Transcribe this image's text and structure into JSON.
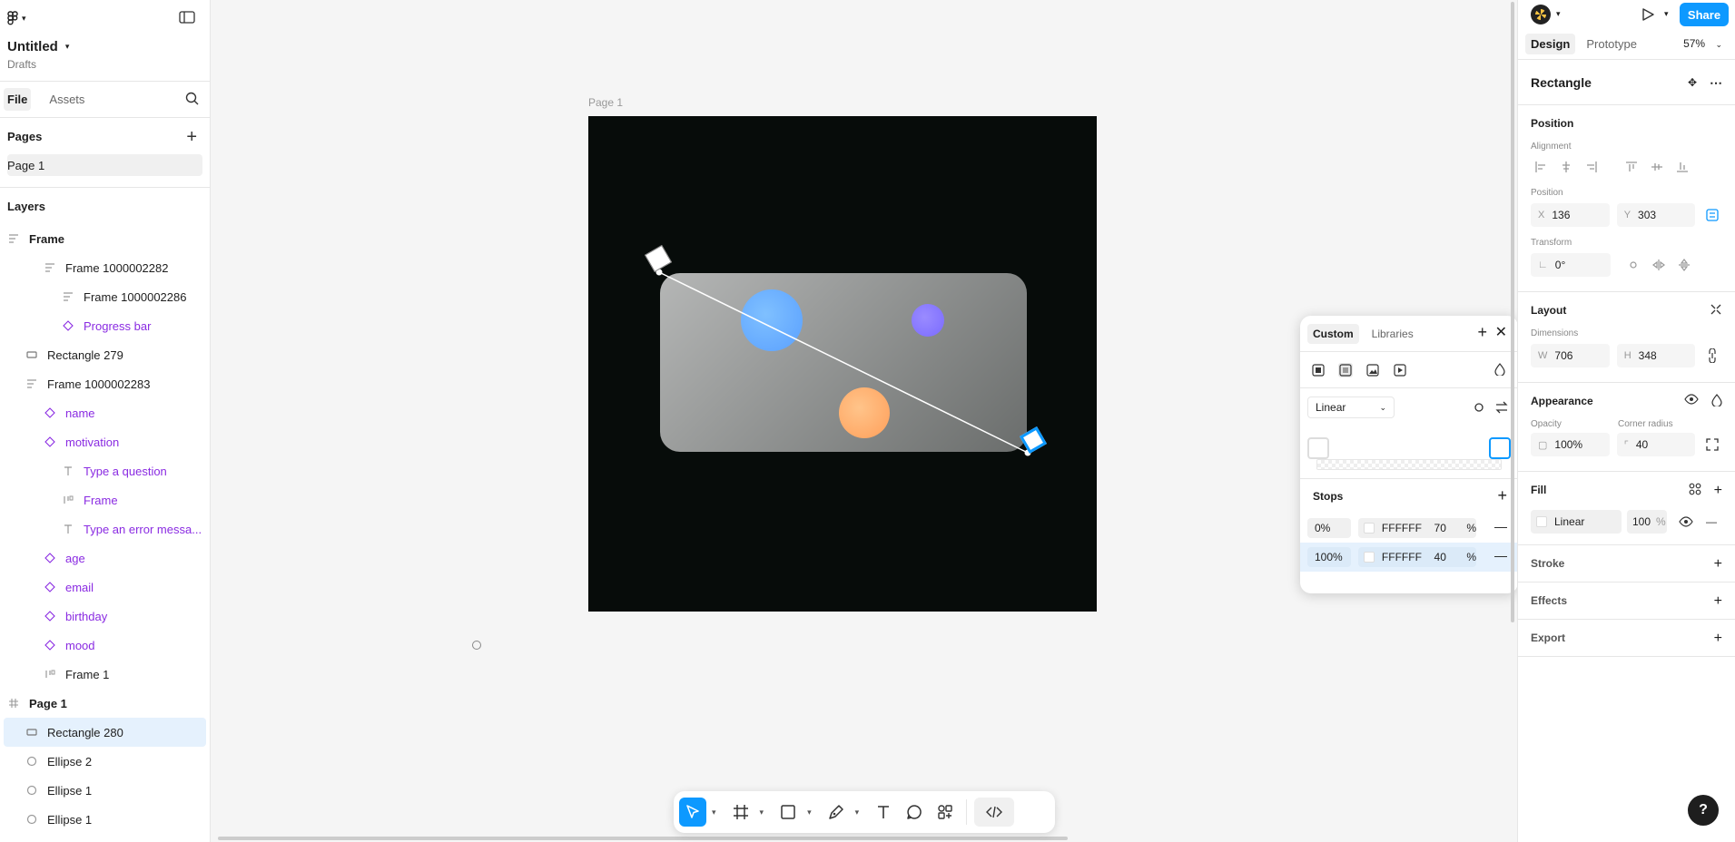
{
  "app": {
    "file_title": "Untitled",
    "file_location": "Drafts"
  },
  "left_panel": {
    "tabs": [
      "File",
      "Assets"
    ],
    "pages_heading": "Pages",
    "pages": [
      "Page 1"
    ],
    "layers_heading": "Layers",
    "layers": [
      {
        "label": "Frame",
        "icon": "frame-layout-icon",
        "depth": 0,
        "color": "default",
        "bold": true
      },
      {
        "label": "Frame 1000002282",
        "icon": "auto-layout-icon",
        "depth": 2,
        "color": "default"
      },
      {
        "label": "Frame 1000002286",
        "icon": "auto-layout-icon",
        "depth": 3,
        "color": "default"
      },
      {
        "label": "Progress bar",
        "icon": "component-instance-icon",
        "depth": 3,
        "color": "purple"
      },
      {
        "label": "Rectangle 279",
        "icon": "rectangle-icon",
        "depth": 1,
        "color": "default"
      },
      {
        "label": "Frame 1000002283",
        "icon": "auto-layout-icon",
        "depth": 1,
        "color": "default"
      },
      {
        "label": "name",
        "icon": "component-instance-icon",
        "depth": 2,
        "color": "purple"
      },
      {
        "label": "motivation",
        "icon": "component-instance-icon",
        "depth": 2,
        "color": "purple"
      },
      {
        "label": "Type a question",
        "icon": "text-icon",
        "depth": 3,
        "color": "purple"
      },
      {
        "label": "Frame",
        "icon": "horizontal-layout-icon",
        "depth": 3,
        "color": "purple"
      },
      {
        "label": "Type an error messa...",
        "icon": "text-icon",
        "depth": 3,
        "color": "purple"
      },
      {
        "label": "age",
        "icon": "component-instance-icon",
        "depth": 2,
        "color": "purple"
      },
      {
        "label": "email",
        "icon": "component-instance-icon",
        "depth": 2,
        "color": "purple"
      },
      {
        "label": "birthday",
        "icon": "component-instance-icon",
        "depth": 2,
        "color": "purple"
      },
      {
        "label": "mood",
        "icon": "component-instance-icon",
        "depth": 2,
        "color": "purple"
      },
      {
        "label": "Frame 1",
        "icon": "horizontal-layout-icon",
        "depth": 2,
        "color": "default"
      },
      {
        "label": "Page 1",
        "icon": "frame-hash-icon",
        "depth": 0,
        "color": "default",
        "bold": true
      },
      {
        "label": "Rectangle 280",
        "icon": "rectangle-icon",
        "depth": 1,
        "color": "default",
        "selected": true
      },
      {
        "label": "Ellipse 2",
        "icon": "ellipse-icon",
        "depth": 1,
        "color": "default"
      },
      {
        "label": "Ellipse 1",
        "icon": "ellipse-icon",
        "depth": 1,
        "color": "default"
      },
      {
        "label": "Ellipse 1",
        "icon": "ellipse-icon",
        "depth": 1,
        "color": "default"
      }
    ]
  },
  "canvas": {
    "frame_label": "Page 1",
    "frame_color": "#070c0a"
  },
  "color_popup": {
    "tabs": [
      "Custom",
      "Libraries"
    ],
    "gradient_type": "Linear",
    "stops_heading": "Stops",
    "stops": [
      {
        "position": "0%",
        "hex": "FFFFFF",
        "opacity": "70",
        "unit": "%"
      },
      {
        "position": "100%",
        "hex": "FFFFFF",
        "opacity": "40",
        "unit": "%"
      }
    ]
  },
  "toolbar": {
    "tools": [
      "move-tool-icon",
      "frame-tool-icon",
      "rectangle-tool-icon",
      "pen-tool-icon",
      "text-tool-icon",
      "comment-tool-icon",
      "actions-icon",
      "dev-mode-icon"
    ]
  },
  "right_panel": {
    "share_label": "Share",
    "tabs": [
      "Design",
      "Prototype"
    ],
    "zoom": "57%",
    "layer_type": "Rectangle",
    "position_heading": "Position",
    "alignment_label": "Alignment",
    "position_label": "Position",
    "x_prefix": "X",
    "x_value": "136",
    "y_prefix": "Y",
    "y_value": "303",
    "transform_label": "Transform",
    "rotation_value": "0°",
    "layout_heading": "Layout",
    "dimensions_label": "Dimensions",
    "w_prefix": "W",
    "w_value": "706",
    "h_prefix": "H",
    "h_value": "348",
    "appearance_heading": "Appearance",
    "opacity_label": "Opacity",
    "opacity_value": "100%",
    "corner_radius_label": "Corner radius",
    "corner_radius_value": "40",
    "fill_heading": "Fill",
    "fill_type": "Linear",
    "fill_opacity": "100",
    "fill_unit": "%",
    "stroke_heading": "Stroke",
    "effects_heading": "Effects",
    "export_heading": "Export"
  },
  "colors": {
    "accent": "#0d99ff",
    "component_purple": "#8a2be2",
    "selection_bg": "#e5f1fd"
  }
}
